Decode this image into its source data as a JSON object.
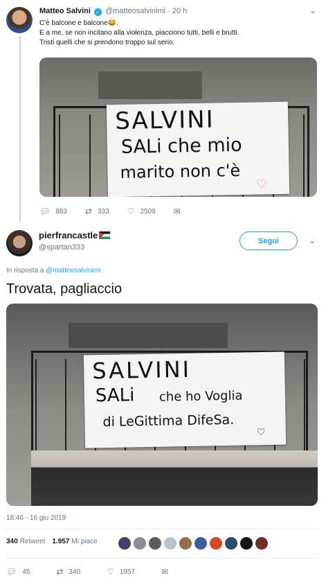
{
  "original_tweet": {
    "name": "Matteo Salvini",
    "handle": "@matteosalvinimi",
    "separator": "·",
    "time": "20 h",
    "text_line1": "C'è balcone e balcone😂.",
    "text_line2": "E a me, se non incitano alla violenza, piacciono tutti, belli e brutti.",
    "text_line3": "Tristi quelli che si prendono troppo sul serio.",
    "banner": {
      "line1": "SALVINI",
      "line2": "SALi che mio",
      "line3": "marito non c'è"
    },
    "actions": {
      "replies": "883",
      "retweets": "333",
      "likes": "2509"
    }
  },
  "reply_tweet": {
    "name": "pierfrancastle",
    "handle": "@spartan333",
    "follow_label": "Segui",
    "reply_prefix": "In risposta a",
    "reply_to": "@matteosalvinimi",
    "text": "Trovata, pagliaccio",
    "banner": {
      "line1": "SALVINI",
      "line2a": "SALi",
      "line2b": "che ho Voglia",
      "line3": "di LeGittima DifeSa."
    },
    "timestamp": "18:46 - 16 giu 2019",
    "retweet_count": "340",
    "retweet_label": "Retweet",
    "like_count": "1.957",
    "like_label": "Mi piace",
    "actions": {
      "replies": "45",
      "retweets": "340",
      "likes": "1957"
    }
  },
  "icons": {
    "reply": "reply-icon",
    "retweet": "retweet-icon",
    "like": "heart-icon",
    "message": "message-icon",
    "verified": "verified-icon",
    "chevron": "chevron-down-icon"
  },
  "colors": {
    "accent": "#1da1f2",
    "muted": "#657786",
    "text": "#14171a"
  }
}
